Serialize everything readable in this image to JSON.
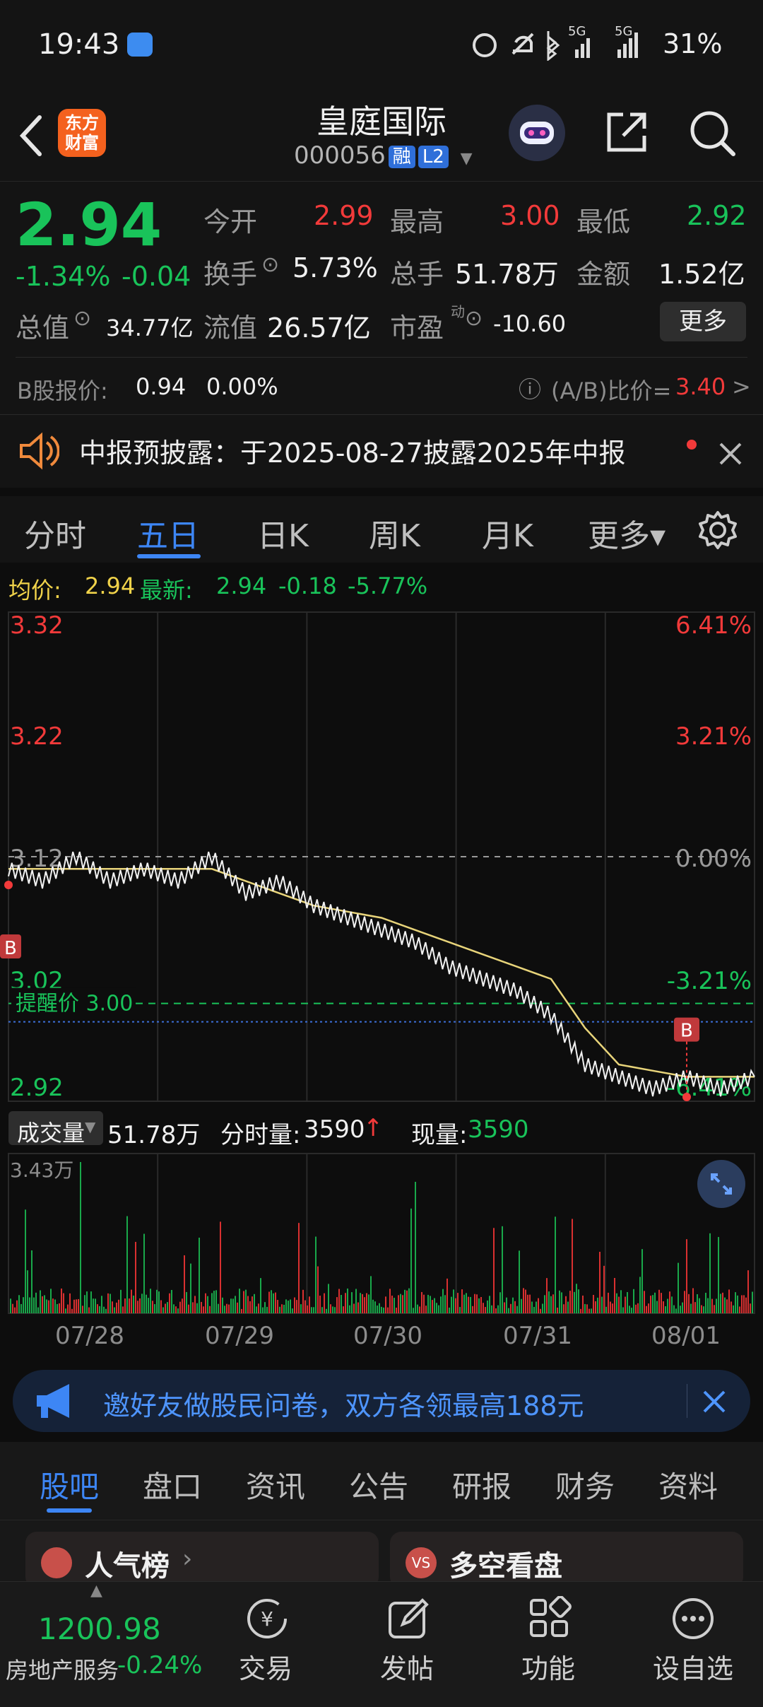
{
  "status_bar": {
    "time": "19:43",
    "battery": "31%",
    "net1": "5G",
    "net2": "5G"
  },
  "header": {
    "back_icon": "back-arrow-icon",
    "logo_text": "东方财富",
    "stock_name": "皇庭国际",
    "stock_code": "000056",
    "tag1": "融",
    "tag2": "L2"
  },
  "quote": {
    "price": "2.94",
    "change_pct": "-1.34%",
    "change_amt": "-0.04",
    "open_label": "今开",
    "open": "2.99",
    "high_label": "最高",
    "high": "3.00",
    "low_label": "最低",
    "low": "2.92",
    "turnover_label": "换手",
    "turnover": "5.73%",
    "volume_label": "总手",
    "volume": "51.78万",
    "amount_label": "金额",
    "amount": "1.52亿",
    "mcap_label": "总值",
    "mcap": "34.77亿",
    "float_label": "流值",
    "float": "26.57亿",
    "pe_label": "市盈",
    "pe_sup": "动",
    "pe": "-10.60",
    "more_label": "更多"
  },
  "b_share": {
    "label": "B股报价:",
    "price": "0.94",
    "pct": "0.00%",
    "ratio_label": "(A/B)比价=",
    "ratio": "3.40",
    "arrow": ">"
  },
  "notice": {
    "text": "中报预披露：于2025-08-27披露2025年中报"
  },
  "chart_tabs": [
    {
      "label": "分时"
    },
    {
      "label": "五日"
    },
    {
      "label": "日K"
    },
    {
      "label": "周K"
    },
    {
      "label": "月K"
    },
    {
      "label": "更多▾"
    }
  ],
  "chart_info": {
    "avg_label": "均价:",
    "avg": "2.94",
    "latest_label": "最新:",
    "latest": "2.94",
    "chg": "-0.18",
    "pct": "-5.77%"
  },
  "chart_data": {
    "type": "line",
    "title": "",
    "x": [
      "07/28",
      "07/29",
      "07/30",
      "07/31",
      "08/01"
    ],
    "y_ticks_left": [
      "3.32",
      "3.22",
      "3.12",
      "3.02",
      "2.92"
    ],
    "y_ticks_right": [
      "6.41%",
      "3.21%",
      "0.00%",
      "-3.21%",
      "-6.41%"
    ],
    "ylim": [
      2.92,
      3.32
    ],
    "prev_close": 3.12,
    "alert_label": "提醒价 3.00",
    "alert_price": 3.0,
    "series": [
      {
        "name": "最新",
        "values": [
          3.11,
          3.1,
          3.12,
          3.1,
          3.11,
          3.1,
          3.12,
          3.09,
          3.1,
          3.08,
          3.07,
          3.06,
          3.05,
          3.03,
          3.02,
          3.01,
          2.99,
          2.95,
          2.94,
          2.93,
          2.94,
          2.93,
          2.94
        ]
      },
      {
        "name": "均价",
        "values": [
          3.11,
          3.11,
          3.11,
          3.11,
          3.11,
          3.11,
          3.11,
          3.1,
          3.09,
          3.08,
          3.075,
          3.07,
          3.06,
          3.05,
          3.04,
          3.03,
          3.02,
          2.98,
          2.95,
          2.945,
          2.94,
          2.94,
          2.94
        ]
      }
    ],
    "volume_label": "成交量",
    "volume_total": "51.78万",
    "volume_max_label": "3.43万",
    "tick_vol_label": "分时量:",
    "tick_vol": "3590",
    "cur_vol_label": "现量:",
    "cur_vol": "3590"
  },
  "promo": {
    "text": "邀好友做股民问卷，双方各领最高188元"
  },
  "bottom_tabs": [
    {
      "label": "股吧"
    },
    {
      "label": "盘口"
    },
    {
      "label": "资讯"
    },
    {
      "label": "公告"
    },
    {
      "label": "研报"
    },
    {
      "label": "财务"
    },
    {
      "label": "资料"
    }
  ],
  "cards": {
    "popular": "人气榜",
    "longshort": "多空看盘"
  },
  "bottom_nav": {
    "index_value": "1200.98",
    "sector": "房地产服务",
    "sector_pct": "-0.24%",
    "trade": "交易",
    "post": "发帖",
    "func": "功能",
    "watch": "设自选"
  }
}
